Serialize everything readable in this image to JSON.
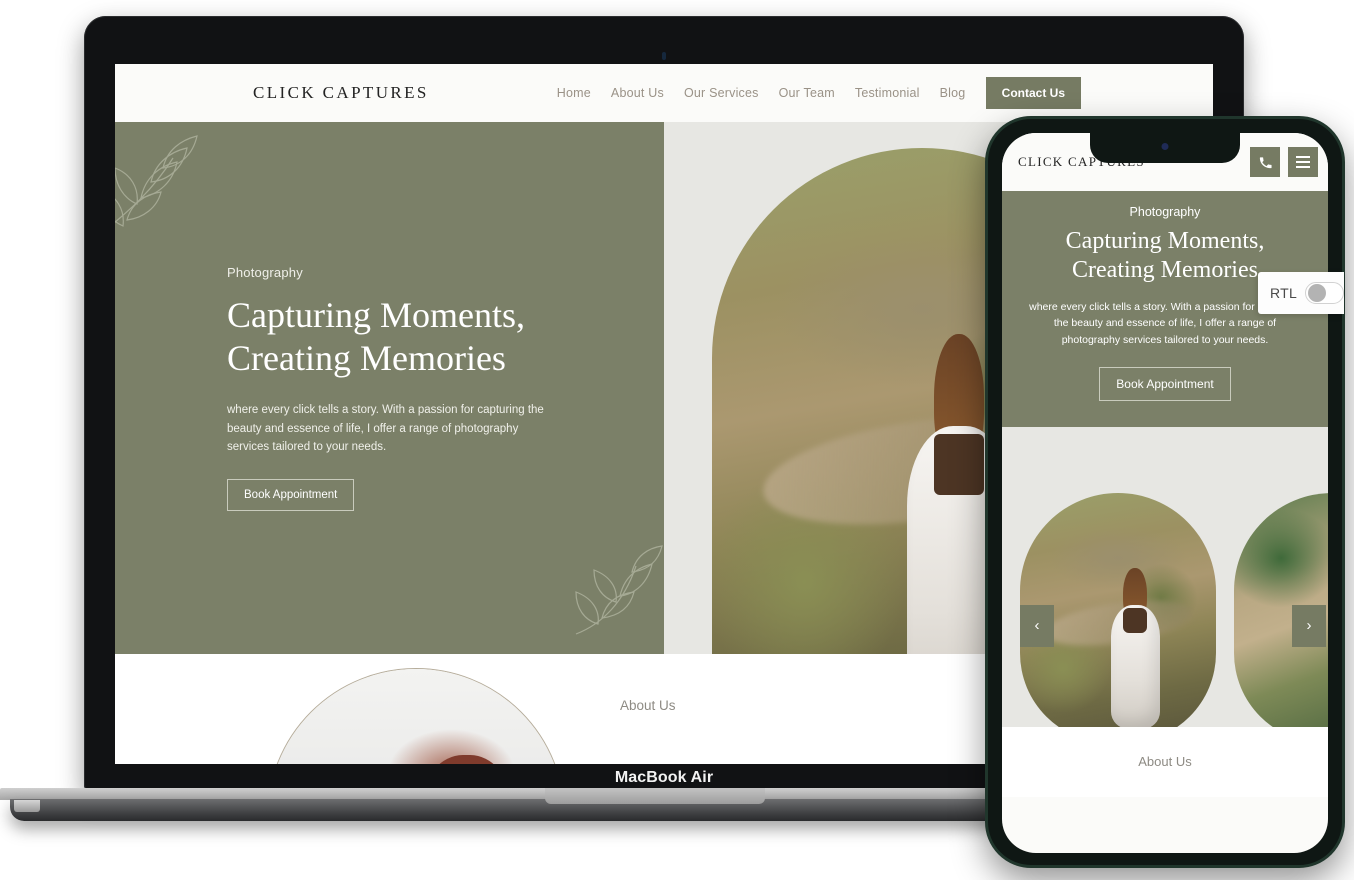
{
  "device": {
    "laptop_label": "MacBook Air",
    "laptop_name": "macbook-air-mockup",
    "phone_name": "iphone-mockup"
  },
  "rtl_widget": {
    "label": "RTL",
    "state": "off"
  },
  "site": {
    "brand": "CLICK CAPTURES",
    "nav": [
      {
        "label": "Home"
      },
      {
        "label": "About Us"
      },
      {
        "label": "Our Services"
      },
      {
        "label": "Our Team"
      },
      {
        "label": "Testimonial"
      },
      {
        "label": "Blog"
      }
    ],
    "contact_button": "Contact Us",
    "hero": {
      "eyebrow": "Photography",
      "title_line1": "Capturing Moments,",
      "title_line2": "Creating Memories",
      "paragraph": "where every click tells a story. With a passion for capturing the beauty and essence of life, I offer a range of photography services tailored to your needs.",
      "cta": "Book Appointment"
    },
    "about": {
      "label": "About Us"
    }
  },
  "mobile": {
    "brand": "CLICK CAPTURES",
    "phone_icon": "phone-icon",
    "menu_icon": "hamburger-menu-icon",
    "hero": {
      "eyebrow": "Photography",
      "title_line1": "Capturing Moments,",
      "title_line2": "Creating Memories",
      "paragraph": "where every click tells a story. With a passion for capturing the beauty and essence of life, I offer a range of photography services tailored to your needs.",
      "cta": "Book Appointment"
    },
    "carousel": {
      "prev": "‹",
      "next": "›"
    },
    "about": {
      "label": "About Us"
    }
  },
  "colors": {
    "olive": "#7b8068",
    "olive_button": "#767b63",
    "page_bg": "#fbfbf9",
    "image_bg": "#e7e7e3",
    "nav_link": "#9a9287",
    "muted_text": "#8e8b84"
  }
}
